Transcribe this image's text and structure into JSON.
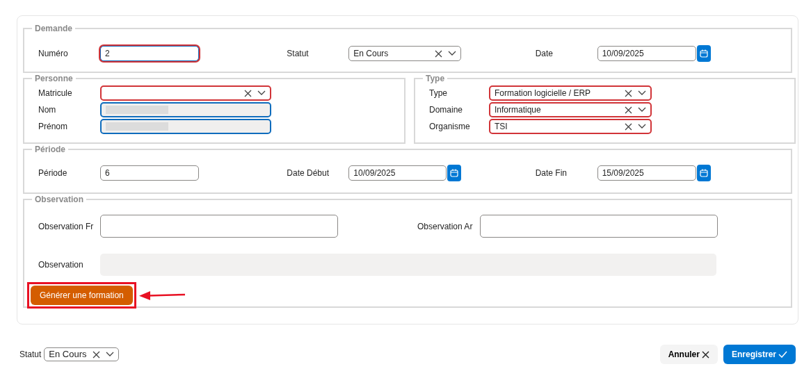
{
  "sections": [
    {
      "legend": "Demande",
      "kind": "row",
      "fields": [
        {
          "label": "Numéro",
          "kind": "text",
          "value": "2",
          "invalid": true,
          "focused": true
        },
        {
          "label": "Statut",
          "kind": "select",
          "value": "En Cours",
          "invalid": false,
          "focused": false
        },
        {
          "label": "Date",
          "kind": "date",
          "value": "10/09/2025",
          "invalid": false,
          "focused": false
        }
      ]
    },
    {
      "legend": "Personne",
      "kind": "column",
      "fields": [
        {
          "label": "Matricule",
          "kind": "select",
          "invalid": true,
          "focused": false
        },
        {
          "label": "Nom",
          "kind": "redacted",
          "invalid": false,
          "focused": true
        },
        {
          "label": "Prénom",
          "kind": "redacted",
          "invalid": false,
          "focused": true
        }
      ]
    },
    {
      "legend": "Type",
      "kind": "column",
      "fields": [
        {
          "label": "Type",
          "kind": "select",
          "value": "Formation logicielle / ERP",
          "invalid": true,
          "focused": false
        },
        {
          "label": "Domaine",
          "kind": "select",
          "value": "Informatique",
          "invalid": true,
          "focused": false
        },
        {
          "label": "Organisme",
          "kind": "select",
          "value": "TSI",
          "invalid": true,
          "focused": false
        }
      ]
    },
    {
      "legend": "Période",
      "kind": "row",
      "fields": [
        {
          "label": "Période",
          "kind": "text",
          "value": "6",
          "invalid": false,
          "focused": false
        },
        {
          "label": "Date Début",
          "kind": "date",
          "value": "10/09/2025",
          "invalid": false,
          "focused": false
        },
        {
          "label": "Date Fin",
          "kind": "date",
          "value": "15/09/2025",
          "invalid": false,
          "focused": false
        }
      ]
    },
    {
      "legend": "Observation",
      "kind": "notes",
      "fields": [
        {
          "label": "Observation Fr",
          "kind": "textarea",
          "invalid": false,
          "focused": false
        },
        {
          "label": "Observation Ar",
          "kind": "textarea",
          "invalid": false,
          "focused": false
        },
        {
          "label": "Observation",
          "kind": "readonly",
          "invalid": false,
          "focused": false
        }
      ],
      "action": {
        "label": "Générer une formation",
        "highlighted": true
      }
    }
  ],
  "footer": {
    "status_label": "Statut",
    "status_value": "En Cours",
    "cancel": "Annuler",
    "save": "Enregistrer"
  }
}
